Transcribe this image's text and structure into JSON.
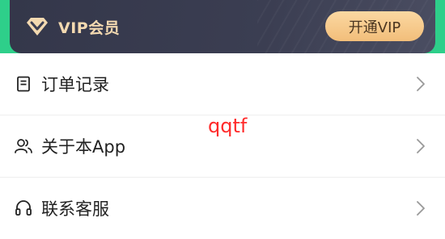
{
  "vip_banner": {
    "title": "VIP会员",
    "open_button_label": "开通VIP",
    "logo_icon": "diamond-icon"
  },
  "menu": {
    "items": [
      {
        "label": "订单记录",
        "icon": "document-icon"
      },
      {
        "label": "关于本App",
        "icon": "users-icon"
      },
      {
        "label": "联系客服",
        "icon": "headset-icon"
      }
    ]
  },
  "watermark_text": "qqtf",
  "colors": {
    "top_bar_green": "#2ecf8a",
    "vip_card_dark": "#3b3e52",
    "vip_gold_text": "#f3d9b0",
    "vip_button_gold": "#f2be7a",
    "watermark_red": "#ff2a2a"
  }
}
